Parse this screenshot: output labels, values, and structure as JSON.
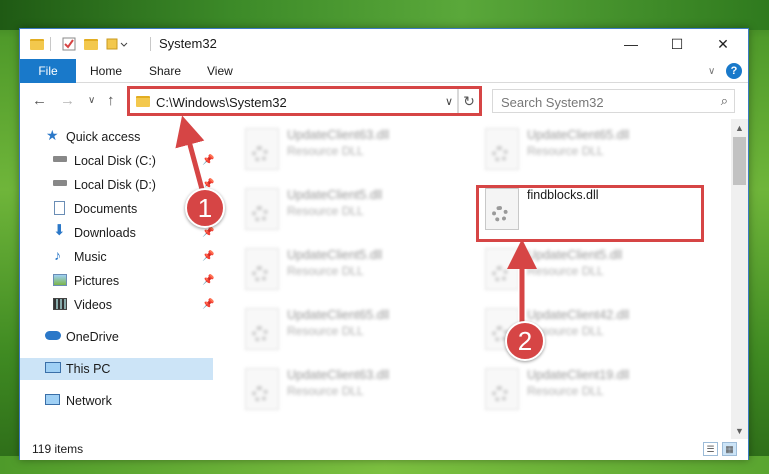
{
  "window": {
    "title": "System32",
    "quick_access_toolbar": [
      "folder-icon",
      "properties-icon",
      "new-folder-icon",
      "customize-icon"
    ],
    "controls": {
      "minimize": "—",
      "maximize": "☐",
      "close": "✕"
    }
  },
  "ribbon": {
    "file_tab": "File",
    "tabs": [
      "Home",
      "Share",
      "View"
    ],
    "help": "?"
  },
  "navigation": {
    "back": "←",
    "forward": "→",
    "recent": "∨",
    "up": "↑",
    "address": "C:\\Windows\\System32",
    "refresh": "↻",
    "search_placeholder": "Search System32"
  },
  "sidebar": {
    "items": [
      {
        "label": "Quick access",
        "icon": "star-icon",
        "pinned": false
      },
      {
        "label": "Local Disk (C:)",
        "icon": "drive-icon",
        "pinned": true
      },
      {
        "label": "Local Disk (D:)",
        "icon": "drive-icon",
        "pinned": true
      },
      {
        "label": "Documents",
        "icon": "documents-icon",
        "pinned": true
      },
      {
        "label": "Downloads",
        "icon": "download-icon",
        "pinned": true
      },
      {
        "label": "Music",
        "icon": "music-icon",
        "pinned": true
      },
      {
        "label": "Pictures",
        "icon": "pictures-icon",
        "pinned": true
      },
      {
        "label": "Videos",
        "icon": "videos-icon",
        "pinned": true
      },
      {
        "label": "OneDrive",
        "icon": "cloud-icon",
        "pinned": false
      },
      {
        "label": "This PC",
        "icon": "computer-icon",
        "pinned": false,
        "selected": true
      },
      {
        "label": "Network",
        "icon": "network-icon",
        "pinned": false
      }
    ]
  },
  "files": [
    {
      "name": "UpdateClient63.dll",
      "type": "Resource DLL",
      "blurred": true
    },
    {
      "name": "UpdateClient65.dll",
      "type": "Resource DLL",
      "blurred": true
    },
    {
      "name": "UpdateClient5.dll",
      "type": "Resource DLL",
      "blurred": true
    },
    {
      "name": "findblocks.dll",
      "type": "",
      "blurred": false,
      "highlighted": true
    },
    {
      "name": "UpdateClient5.dll",
      "type": "Resource DLL",
      "blurred": true
    },
    {
      "name": "UpdateClient5.dll",
      "type": "Resource DLL",
      "blurred": true
    },
    {
      "name": "UpdateClient65.dll",
      "type": "Resource DLL",
      "blurred": true
    },
    {
      "name": "UpdateClient42.dll",
      "type": "Resource DLL",
      "blurred": true
    },
    {
      "name": "UpdateClient63.dll",
      "type": "Resource DLL",
      "blurred": true
    },
    {
      "name": "UpdateClient19.dll",
      "type": "Resource DLL",
      "blurred": true
    }
  ],
  "status": {
    "item_count": "119 items"
  },
  "annotations": {
    "step1": "1",
    "step2": "2",
    "highlight_color": "#d64545"
  }
}
